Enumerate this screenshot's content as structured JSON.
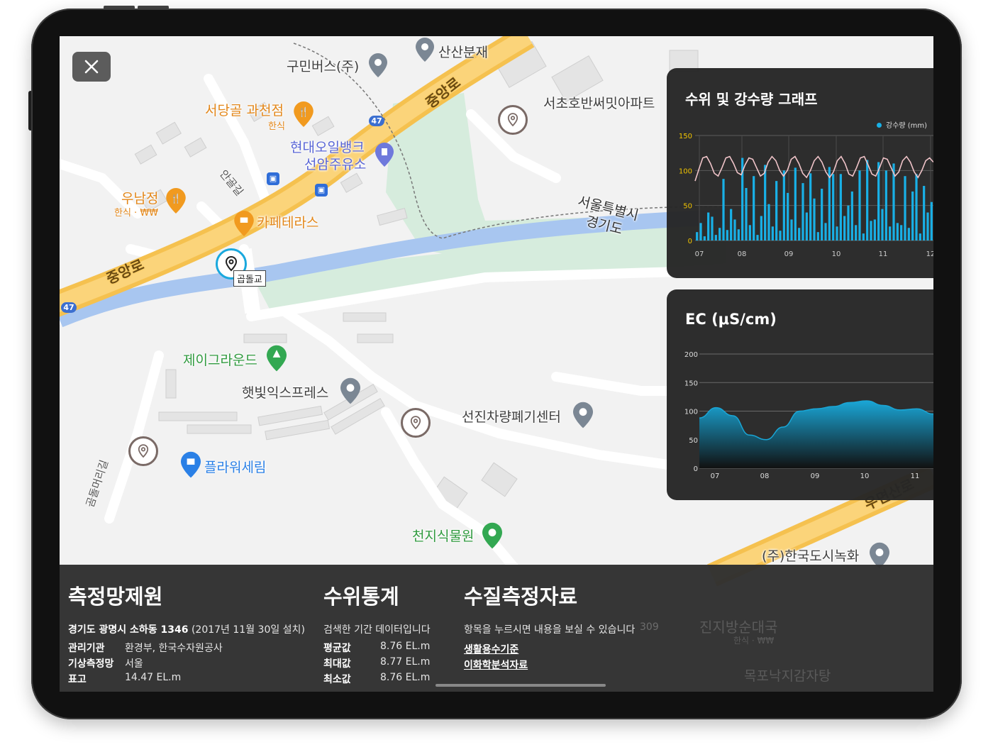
{
  "map": {
    "pois": [
      {
        "name": "구민버스(주)",
        "color": "#3f3f3f"
      },
      {
        "name": "산산분재",
        "color": "#3f3f3f"
      },
      {
        "name": "서당골 과천점",
        "sub": "한식",
        "color": "#e3871a"
      },
      {
        "name": "현대오일뱅크",
        "name2": "선암주유소",
        "color": "#5865d6"
      },
      {
        "name": "서초호반써밋아파트",
        "color": "#3f3f3f"
      },
      {
        "name": "우남정",
        "sub": "한식 · ₩₩",
        "color": "#e3871a"
      },
      {
        "name": "카페테라스",
        "color": "#e3871a"
      },
      {
        "name": "서울특별시",
        "name2": "경기도",
        "color": "#333"
      },
      {
        "name": "제이그라운드",
        "color": "#2f9a3e"
      },
      {
        "name": "햇빛익스프레스",
        "color": "#3f3f3f"
      },
      {
        "name": "선진차량폐기센터",
        "color": "#3f3f3f"
      },
      {
        "name": "플라워세림",
        "color": "#2a80e6"
      },
      {
        "name": "천지식물원",
        "color": "#2f9a3e"
      },
      {
        "name": "(주)한국도시녹화",
        "color": "#3f3f3f"
      },
      {
        "name": "진지방순대국",
        "sub": "한식 · ₩₩",
        "color": "#e3871a"
      },
      {
        "name": "목포낙지감자탕",
        "color": "#e3871a"
      }
    ],
    "roads": [
      "중앙로",
      "중앙로",
      "안골길",
      "곰돌머리길",
      "우면산로"
    ],
    "route_badge": "47",
    "bridge": "곱돌교",
    "bg_text": "309"
  },
  "close_button": {
    "icon": "close-icon"
  },
  "panels": {
    "water_rain": {
      "title": "수위 및 강수량 그래프",
      "legend": "강수량 (mm)"
    },
    "ec": {
      "title": "EC (μS/cm)"
    }
  },
  "chart_data": [
    {
      "type": "bar",
      "title": "수위 및 강수량 그래프",
      "legend": [
        "강수량 (mm)"
      ],
      "y_ticks": [
        "0",
        "50",
        "100",
        "150"
      ],
      "ylim": [
        0,
        150
      ],
      "x_ticks": [
        "07",
        "08",
        "09",
        "10",
        "11",
        "12"
      ],
      "series": [
        {
          "name": "강수량 (mm)",
          "type": "bar",
          "values": [
            12,
            25,
            6,
            40,
            34,
            8,
            18,
            88,
            15,
            45,
            30,
            16,
            118,
            75,
            22,
            92,
            8,
            35,
            108,
            52,
            20,
            85,
            14,
            100,
            68,
            30,
            104,
            18,
            82,
            40,
            96,
            60,
            12,
            74,
            25,
            105,
            95,
            20,
            95,
            35,
            50,
            70,
            22,
            100,
            10,
            115,
            28,
            30,
            112,
            45,
            100,
            20,
            110,
            25,
            22,
            92,
            18,
            70,
            95,
            10,
            78,
            40,
            55
          ]
        },
        {
          "type": "line",
          "color": "#f0c4c9",
          "values": [
            85,
            102,
            118,
            120,
            110,
            96,
            92,
            104,
            118,
            120,
            110,
            97,
            94,
            108,
            118,
            116,
            104,
            92,
            96,
            112,
            120,
            114,
            100,
            92,
            100,
            116,
            120,
            110,
            96,
            90,
            100,
            114,
            120,
            112,
            98,
            90,
            98,
            114,
            120,
            110,
            95,
            92,
            104,
            118,
            120,
            108,
            95,
            92,
            104,
            118,
            116,
            104,
            92,
            98,
            114,
            120,
            112,
            98,
            90,
            100,
            114,
            118,
            112
          ]
        }
      ]
    },
    {
      "type": "area",
      "title": "EC (μS/cm)",
      "y_ticks": [
        "0",
        "50",
        "100",
        "150",
        "200"
      ],
      "ylim": [
        0,
        200
      ],
      "x_ticks": [
        "07",
        "08",
        "09",
        "10",
        "11"
      ],
      "x": [
        0,
        0.5,
        1,
        1.5,
        2,
        2.5,
        3,
        3.5,
        4,
        4.5,
        5,
        5.5,
        6,
        6.5,
        7
      ],
      "values": [
        88,
        106,
        92,
        58,
        50,
        72,
        100,
        104,
        108,
        115,
        118,
        110,
        102,
        104,
        95
      ]
    }
  ],
  "bottom": {
    "network": {
      "title": "측정망제원",
      "address_bold": "경기도 광명시 소하동 1346",
      "address_note": "(2017년 11월 30일 설치)",
      "rows": [
        {
          "label": "관리기관",
          "value": "환경부, 한국수자원공사"
        },
        {
          "label": "기상측정망",
          "value": "서울"
        },
        {
          "label": "표고",
          "value": "14.47 EL.m"
        }
      ]
    },
    "stats": {
      "title": "수위통계",
      "desc": "검색한 기간 데이터입니다",
      "rows": [
        {
          "label": "평균값",
          "value": "8.76 EL.m"
        },
        {
          "label": "최대값",
          "value": "8.77 EL.m"
        },
        {
          "label": "최소값",
          "value": "8.76 EL.m"
        }
      ]
    },
    "quality": {
      "title": "수질측정자료",
      "desc": "항목을 누르시면 내용을 보실 수 있습니다",
      "links": [
        "생활용수기준",
        "이화학분석자료"
      ]
    }
  }
}
